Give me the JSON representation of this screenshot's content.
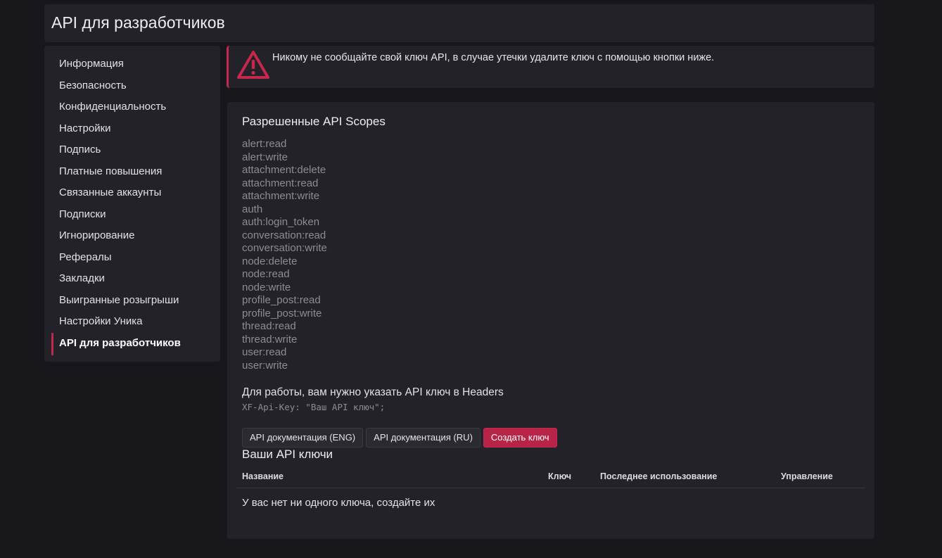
{
  "page": {
    "title": "API для разработчиков"
  },
  "sidebar": {
    "items": [
      {
        "label": "Информация"
      },
      {
        "label": "Безопасность"
      },
      {
        "label": "Конфиденциальность"
      },
      {
        "label": "Настройки"
      },
      {
        "label": "Подпись"
      },
      {
        "label": "Платные повышения"
      },
      {
        "label": "Связанные аккаунты"
      },
      {
        "label": "Подписки"
      },
      {
        "label": "Игнорирование"
      },
      {
        "label": "Рефералы"
      },
      {
        "label": "Закладки"
      },
      {
        "label": "Выигранные розыгрыши"
      },
      {
        "label": "Настройки Уника"
      },
      {
        "label": "API для разработчиков",
        "active": true
      }
    ]
  },
  "alert": {
    "icon": "warning-triangle-icon",
    "text": "Никому не сообщайте свой ключ API, в случае утечки удалите ключ с помощью кнопки ниже."
  },
  "scopes": {
    "title": "Разрешенные API Scopes",
    "items": [
      "alert:read",
      "alert:write",
      "attachment:delete",
      "attachment:read",
      "attachment:write",
      "auth",
      "auth:login_token",
      "conversation:read",
      "conversation:write",
      "node:delete",
      "node:read",
      "node:write",
      "profile_post:read",
      "profile_post:write",
      "thread:read",
      "thread:write",
      "user:read",
      "user:write"
    ]
  },
  "info": {
    "text": "Для работы, вам нужно указать API ключ в Headers",
    "code": "XF-Api-Key: \"Ваш API ключ\";"
  },
  "buttons": {
    "docs_eng": "API документация (ENG)",
    "docs_ru": "API документация (RU)",
    "create_key": "Создать ключ"
  },
  "keys": {
    "title": "Ваши API ключи",
    "columns": {
      "name": "Название",
      "key": "Ключ",
      "last_used": "Последнее использование",
      "manage": "Управление"
    },
    "empty": "У вас нет ни одного ключа, создайте их"
  },
  "colors": {
    "accent": "#c6274d",
    "background": "#18171c",
    "panel": "#232228",
    "muted": "#8d8c93"
  }
}
